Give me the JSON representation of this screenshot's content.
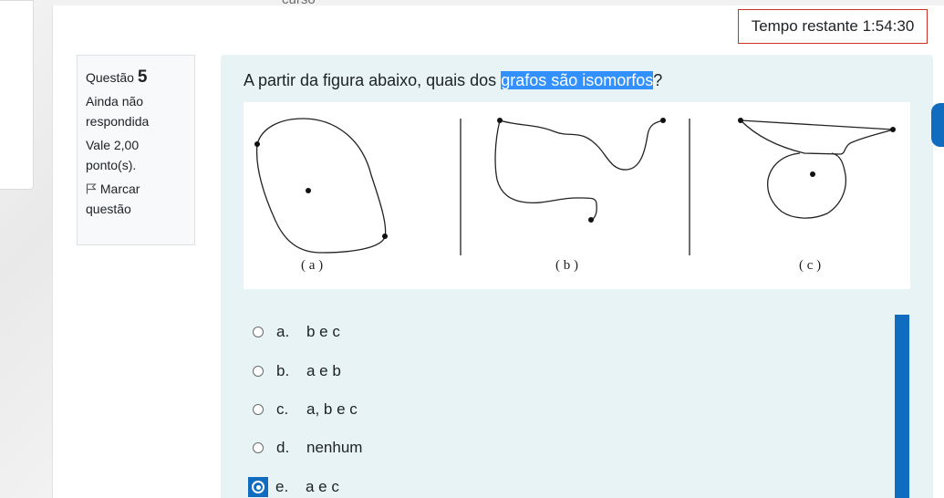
{
  "header": {
    "crumb": "curso"
  },
  "timer": {
    "label": "Tempo restante 1:54:30"
  },
  "question_info": {
    "label": "Questão",
    "number": "5",
    "status_line1": "Ainda não",
    "status_line2": "respondida",
    "grade_line1": "Vale 2,00",
    "grade_line2": "ponto(s).",
    "flag_line1": "Marcar",
    "flag_line2": "questão"
  },
  "question": {
    "text_before": "A partir da figura abaixo, quais dos ",
    "text_highlight": "grafos são isomorfos",
    "text_after": "?",
    "figure_labels": [
      "( a )",
      "( b )",
      "( c )"
    ]
  },
  "answers": [
    {
      "letter": "a.",
      "text": "b e c",
      "selected": false
    },
    {
      "letter": "b.",
      "text": "a e b",
      "selected": false
    },
    {
      "letter": "c.",
      "text": "a, b e c",
      "selected": false
    },
    {
      "letter": "d.",
      "text": "nenhum",
      "selected": false
    },
    {
      "letter": "e.",
      "text": "a e c",
      "selected": true
    }
  ],
  "colors": {
    "accent": "#0f6cbf",
    "timer_border": "#ca3120",
    "question_bg": "#e7f3f5",
    "highlight": "#3390ff"
  },
  "icons": {
    "flag": "flag-icon"
  }
}
